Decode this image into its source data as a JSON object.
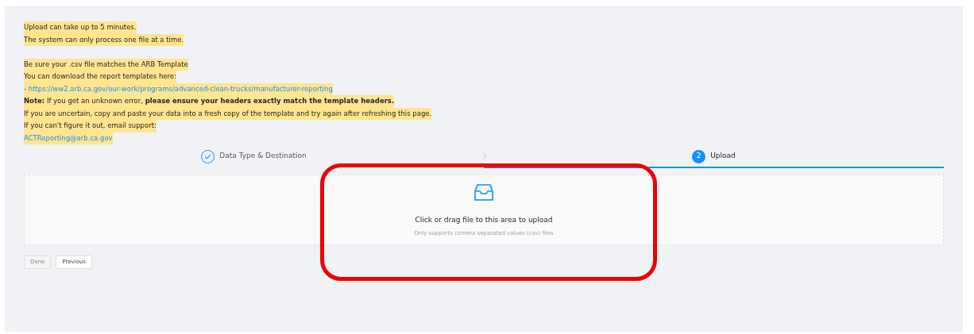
{
  "notice": {
    "paragraphs": [
      [
        {
          "kind": "text",
          "text": "Upload can take up to 5 minutes."
        },
        {
          "kind": "text",
          "text": "The system can only process one file at a time."
        }
      ],
      [
        {
          "kind": "text",
          "text": "Be sure your .csv file matches the ARB Template"
        },
        {
          "kind": "text",
          "text": "You can download the report templates here:"
        },
        {
          "kind": "link",
          "prefix": "- ",
          "text": "https://ww2.arb.ca.gov/our-work/programs/advanced-clean-trucks/manufacturer-reporting"
        },
        {
          "kind": "text",
          "text": "**Note:** If you get an unknown error, **please ensure your headers exactly match the template headers.**"
        },
        {
          "kind": "text",
          "text": "If you are uncertain, copy and paste your data into a fresh copy of the template and try again after refreshing this page."
        },
        {
          "kind": "text",
          "text": "If you can't figure it out, email support:"
        },
        {
          "kind": "link",
          "text": "ACTReporting@arb.ca.gov"
        }
      ]
    ]
  },
  "steps": [
    {
      "label": "Data Type & Destination",
      "done": true,
      "selected": false
    },
    {
      "label": "Upload",
      "number": "2",
      "done": false,
      "selected": true
    }
  ],
  "dropzone": {
    "title": "Click or drag file to this area to upload",
    "hint": "Only supports comma separated values (csv) files"
  },
  "buttons": [
    {
      "label": "Done",
      "disabled": true
    },
    {
      "label": "Previous",
      "disabled": false
    }
  ]
}
